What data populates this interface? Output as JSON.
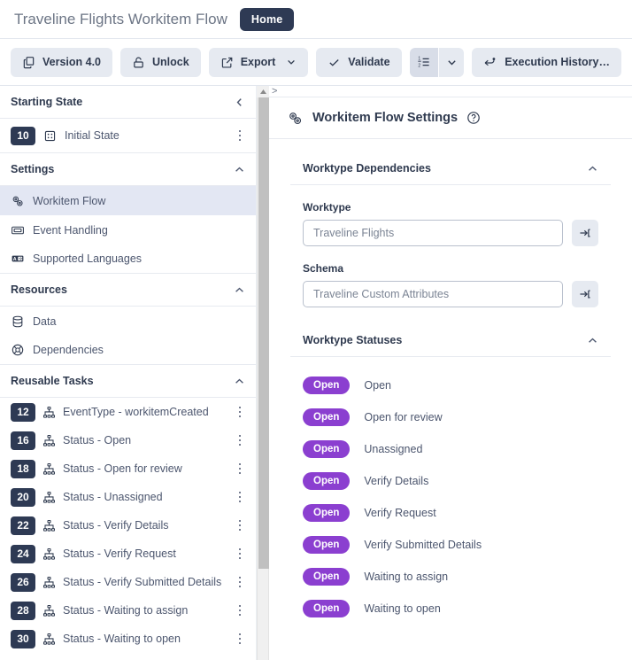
{
  "titlebar": {
    "app_title": "Traveline Flights Workitem Flow",
    "home_tab": "Home"
  },
  "toolbar": {
    "version_label": "Version 4.0",
    "unlock_label": "Unlock",
    "export_label": "Export",
    "validate_label": "Validate",
    "execution_history_label": "Execution History…",
    "icons": {
      "version": "copy-icon",
      "unlock": "unlock-icon",
      "export": "external-link-icon",
      "export_chevron": "chevron-down-icon",
      "validate": "check-icon",
      "ordered_list": "numbered-list-icon",
      "list_chevron": "chevron-down-icon",
      "execution_history": "history-back-icon"
    }
  },
  "sidebar": {
    "sections": [
      {
        "title": "Starting State",
        "chevron": "chevron-left-icon"
      },
      {
        "title": "Settings",
        "chevron": "chevron-up-icon"
      },
      {
        "title": "Resources",
        "chevron": "chevron-up-icon"
      },
      {
        "title": "Reusable Tasks",
        "chevron": "chevron-up-icon"
      }
    ],
    "starting_state": [
      {
        "badge": "10",
        "label": "Initial State",
        "icon": "state-node-icon",
        "menu": "kebab-menu-icon"
      }
    ],
    "settings_items": [
      {
        "label": "Workitem Flow",
        "icon": "gears-icon",
        "selected": true
      },
      {
        "label": "Event Handling",
        "icon": "event-card-icon",
        "selected": false
      },
      {
        "label": "Supported Languages",
        "icon": "language-icon",
        "selected": false
      }
    ],
    "resources_items": [
      {
        "label": "Data",
        "icon": "database-icon"
      },
      {
        "label": "Dependencies",
        "icon": "lifebuoy-icon"
      }
    ],
    "reusable_tasks": [
      {
        "badge": "12",
        "label": "EventType - workitemCreated",
        "icon": "hierarchy-icon"
      },
      {
        "badge": "16",
        "label": "Status - Open",
        "icon": "hierarchy-icon"
      },
      {
        "badge": "18",
        "label": "Status - Open for review",
        "icon": "hierarchy-icon"
      },
      {
        "badge": "20",
        "label": "Status - Unassigned",
        "icon": "hierarchy-icon"
      },
      {
        "badge": "22",
        "label": "Status - Verify Details",
        "icon": "hierarchy-icon"
      },
      {
        "badge": "24",
        "label": "Status - Verify Request",
        "icon": "hierarchy-icon"
      },
      {
        "badge": "26",
        "label": "Status - Verify Submitted Details",
        "icon": "hierarchy-icon"
      },
      {
        "badge": "28",
        "label": "Status - Waiting to assign",
        "icon": "hierarchy-icon"
      },
      {
        "badge": "30",
        "label": "Status - Waiting to open",
        "icon": "hierarchy-icon"
      }
    ]
  },
  "scrollbar": {
    "up_arrow": "scroll-up-arrow-icon"
  },
  "panel": {
    "expand_marker": ">",
    "title": "Workitem Flow Settings",
    "title_icon": "gears-icon",
    "help_icon": "help-circle-icon",
    "worktype_dependencies": {
      "title": "Worktype Dependencies",
      "chevron": "chevron-up-icon",
      "worktype_label": "Worktype",
      "worktype_value": "Traveline Flights",
      "schema_label": "Schema",
      "schema_value": "Traveline Custom Attributes",
      "go_icon": "open-in-icon"
    },
    "worktype_statuses": {
      "title": "Worktype Statuses",
      "chevron": "chevron-up-icon",
      "items": [
        {
          "pill": "Open",
          "name": "Open"
        },
        {
          "pill": "Open",
          "name": "Open for review"
        },
        {
          "pill": "Open",
          "name": "Unassigned"
        },
        {
          "pill": "Open",
          "name": "Verify Details"
        },
        {
          "pill": "Open",
          "name": "Verify Request"
        },
        {
          "pill": "Open",
          "name": "Verify Submitted Details"
        },
        {
          "pill": "Open",
          "name": "Waiting to assign"
        },
        {
          "pill": "Open",
          "name": "Waiting to open"
        }
      ]
    }
  },
  "colors": {
    "accent_navy": "#2e3a54",
    "status_purple": "#8b3fd0",
    "button_grey": "#e6eaf1",
    "selected_row": "#e3e7f3"
  }
}
